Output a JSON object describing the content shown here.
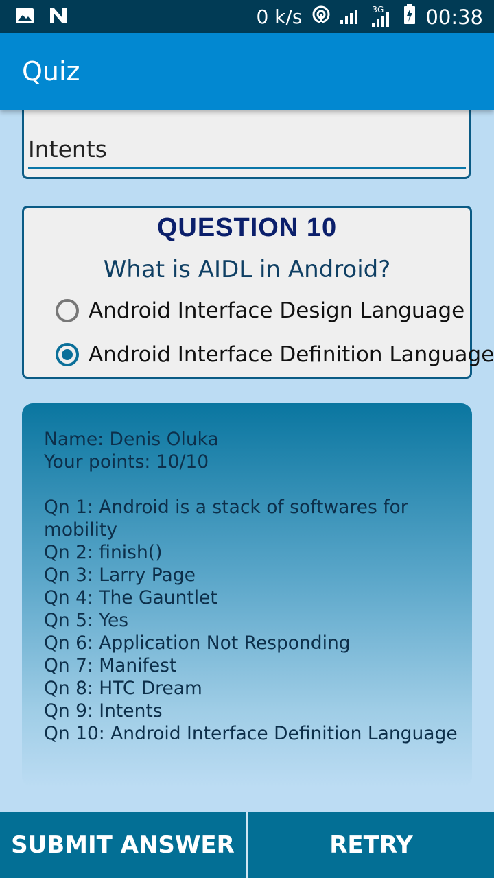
{
  "status_bar": {
    "network_speed": "0 k/s",
    "network_type": "3G",
    "time": "00:38",
    "icons": [
      "image-icon",
      "n-icon",
      "hotspot-icon",
      "signal-icon",
      "signal-3g-icon",
      "battery-charging-icon"
    ]
  },
  "app_bar": {
    "title": "Quiz"
  },
  "previous_card": {
    "answer_text": "Intents"
  },
  "question": {
    "heading": "QUESTION 10",
    "text": "What is AIDL in Android?",
    "options": [
      {
        "label": "Android Interface Design Language",
        "selected": false
      },
      {
        "label": "Android Interface Definition Language",
        "selected": true
      }
    ]
  },
  "results": {
    "name": "Name: Denis Oluka",
    "points": "Your points:  10/10",
    "answers": [
      "Qn 1: Android is a stack of softwares for mobility",
      "Qn 2: finish()",
      "Qn 3: Larry Page",
      "Qn 4: The Gauntlet",
      "Qn 5: Yes",
      "Qn 6: Application Not Responding",
      "Qn 7: Manifest",
      "Qn 8: HTC Dream",
      "Qn 9: Intents",
      "Qn 10: Android Interface Definition Language"
    ]
  },
  "buttons": {
    "submit": "SUBMIT ANSWER",
    "retry": "RETRY"
  },
  "colors": {
    "primary": "#0288d1",
    "status_bar": "#013b55",
    "button_bar": "#036f95",
    "accent": "#0a6f99"
  }
}
